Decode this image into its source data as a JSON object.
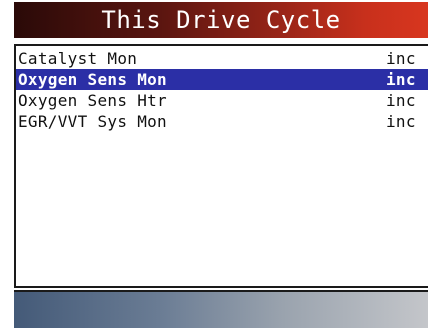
{
  "header": {
    "title": "This Drive Cycle"
  },
  "monitors": [
    {
      "label": "Catalyst Mon",
      "value": "inc",
      "selected": false
    },
    {
      "label": "Oxygen Sens Mon",
      "value": "inc",
      "selected": true
    },
    {
      "label": "Oxygen Sens Htr",
      "value": "inc",
      "selected": false
    },
    {
      "label": "EGR/VVT Sys Mon",
      "value": "inc",
      "selected": false
    }
  ],
  "colors": {
    "title_bar_dark": "#2a0a08",
    "title_bar_bright": "#d8361f",
    "selection_highlight": "#2b2fa6",
    "status_bar_left": "#445a78",
    "status_bar_right": "#c4c6ca"
  }
}
